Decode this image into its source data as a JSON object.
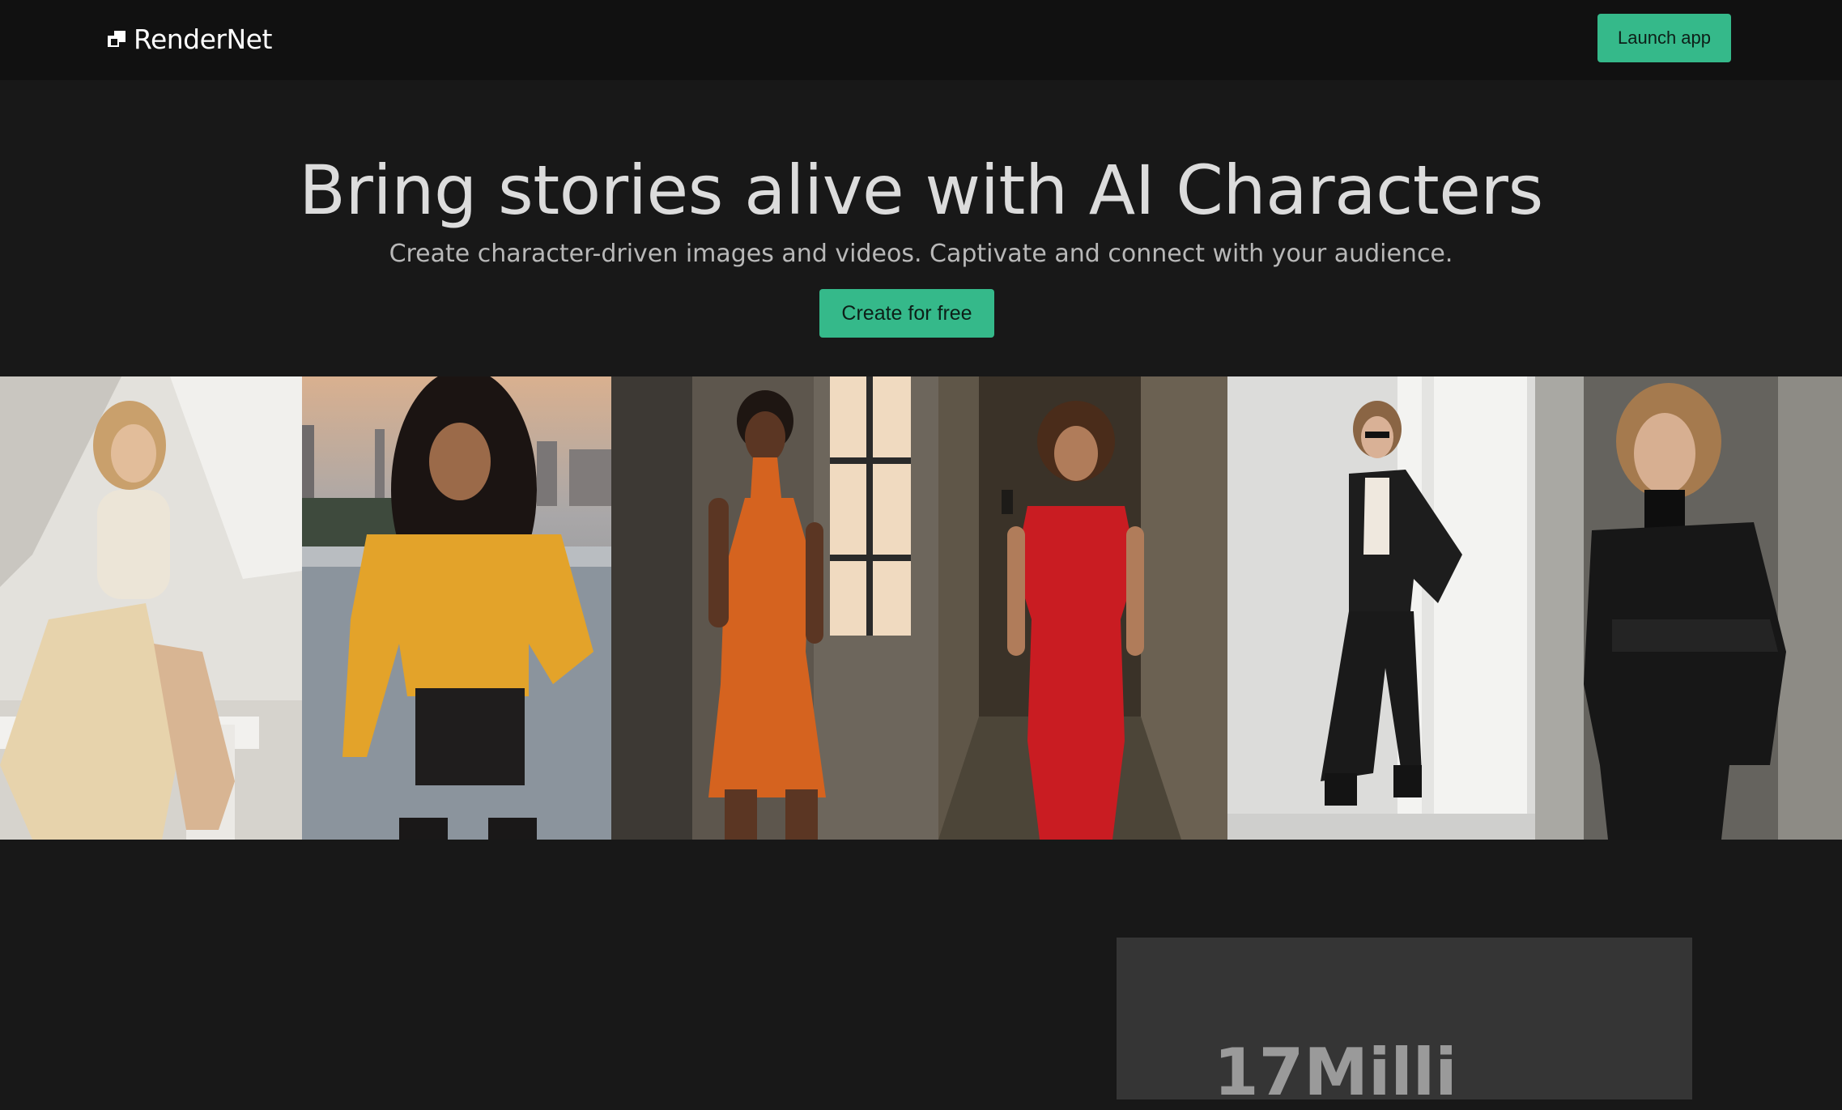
{
  "nav": {
    "brand": "RenderNet",
    "launch_label": "Launch app"
  },
  "hero": {
    "title": "Bring stories alive with AI Characters",
    "subtitle": "Create character-driven images and videos. Captivate and connect with your audience.",
    "cta_label": "Create for free"
  },
  "gallery": [
    {
      "name": "gallery-image-cream-outfit",
      "bg": "#d9d6d0",
      "accent": "#eadcc4"
    },
    {
      "name": "gallery-image-yellow-sweater",
      "bg": "#7d8791",
      "accent": "#e3a32a"
    },
    {
      "name": "gallery-image-orange-dress",
      "bg": "#5a554d",
      "accent": "#d5631f"
    },
    {
      "name": "gallery-image-red-dress",
      "bg": "#3b3328",
      "accent": "#c91c22"
    },
    {
      "name": "gallery-image-black-suit",
      "bg": "#d8d8d6",
      "accent": "#1b1b1b"
    },
    {
      "name": "gallery-image-leather-jacket",
      "bg": "#6a6863",
      "accent": "#151515"
    }
  ],
  "stats": {
    "headline": "17Milli"
  },
  "colors": {
    "accent": "#35b98a",
    "background": "#181818",
    "topbar": "#111111"
  }
}
